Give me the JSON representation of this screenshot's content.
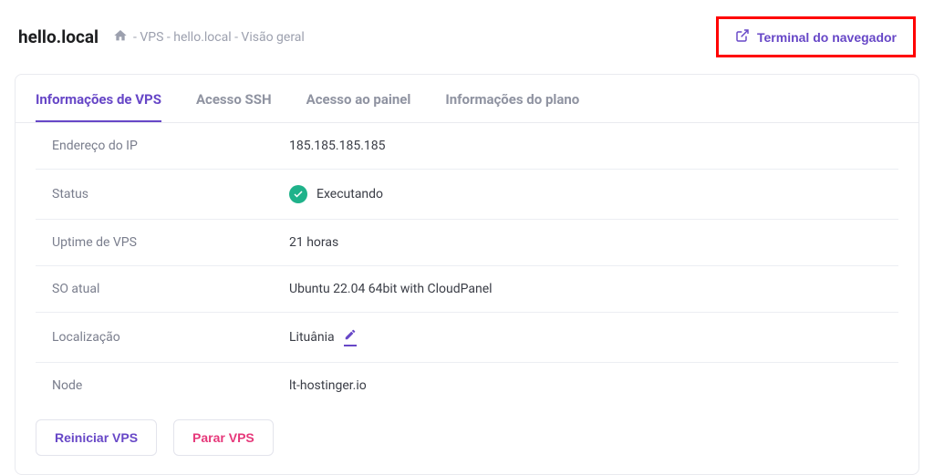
{
  "header": {
    "hostname": "hello.local",
    "breadcrumb": "- VPS - hello.local - Visão geral",
    "terminal_label": "Terminal do navegador"
  },
  "tabs": {
    "info": "Informações de VPS",
    "ssh": "Acesso SSH",
    "panel": "Acesso ao painel",
    "plan": "Informações do plano"
  },
  "info": {
    "ip_label": "Endereço do IP",
    "ip_value": "185.185.185.185",
    "status_label": "Status",
    "status_value": "Executando",
    "uptime_label": "Uptime de VPS",
    "uptime_value": "21 horas",
    "os_label": "SO atual",
    "os_value": "Ubuntu 22.04 64bit with CloudPanel",
    "location_label": "Localização",
    "location_value": "Lituânia",
    "node_label": "Node",
    "node_value": "lt-hostinger.io"
  },
  "actions": {
    "restart": "Reiniciar VPS",
    "stop": "Parar VPS"
  }
}
